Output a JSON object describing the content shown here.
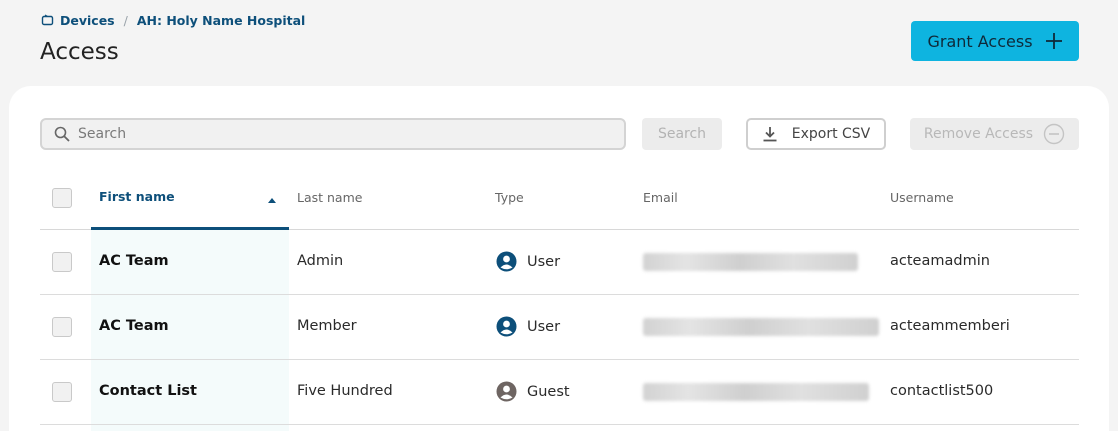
{
  "breadcrumb": {
    "items": [
      "Devices",
      "AH: Holy Name Hospital"
    ],
    "separator": "/",
    "icon": "device-icon"
  },
  "page": {
    "title": "Access"
  },
  "grant_button": {
    "label": "Grant Access",
    "icon": "plus-icon"
  },
  "toolbar": {
    "search_placeholder": "Search",
    "search_value": "",
    "search_button": "Search",
    "export_button": "Export CSV",
    "remove_button": "Remove Access"
  },
  "table": {
    "columns": {
      "first_name": "First name",
      "last_name": "Last name",
      "type": "Type",
      "email": "Email",
      "username": "Username"
    },
    "sort": {
      "column": "First name",
      "direction": "ascending"
    },
    "rows": [
      {
        "first_name": "AC Team",
        "last_name": "Admin",
        "type": "User",
        "type_icon": "user-icon",
        "email": "(redacted)",
        "username": "acteamadmin"
      },
      {
        "first_name": "AC Team",
        "last_name": "Member",
        "type": "User",
        "type_icon": "user-icon",
        "email": "(redacted)",
        "username": "acteammemberi"
      },
      {
        "first_name": "Contact List",
        "last_name": "Five Hundred",
        "type": "Guest",
        "type_icon": "guest-icon",
        "email": "(redacted)",
        "username": "contactlist500"
      }
    ]
  },
  "colors": {
    "accent": "#0eb4e0",
    "link": "#0d4f7a",
    "user_icon": "#0d4f7a",
    "guest_icon": "#6e6562"
  }
}
